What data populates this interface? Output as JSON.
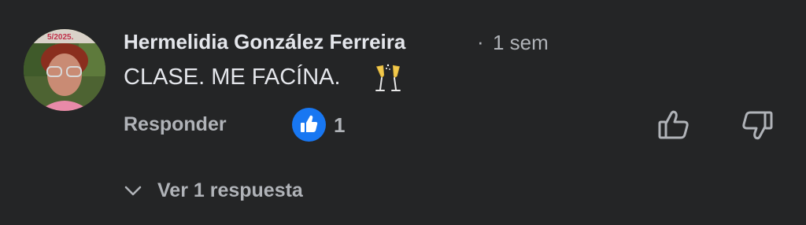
{
  "comment": {
    "avatar_icon": "profile-photo",
    "avatar_overlay_text": "5/2025.",
    "author": "Hermelidia González Ferreira",
    "separator": "·",
    "time": "1 sem",
    "text": "CLASE. ME FACÍNA.",
    "emoji_icon": "champagne-glasses-icon",
    "reply_label": "Responder",
    "like_count": "1",
    "like_badge_color": "#1877f2",
    "view_replies_label": "Ver 1 respuesta"
  }
}
